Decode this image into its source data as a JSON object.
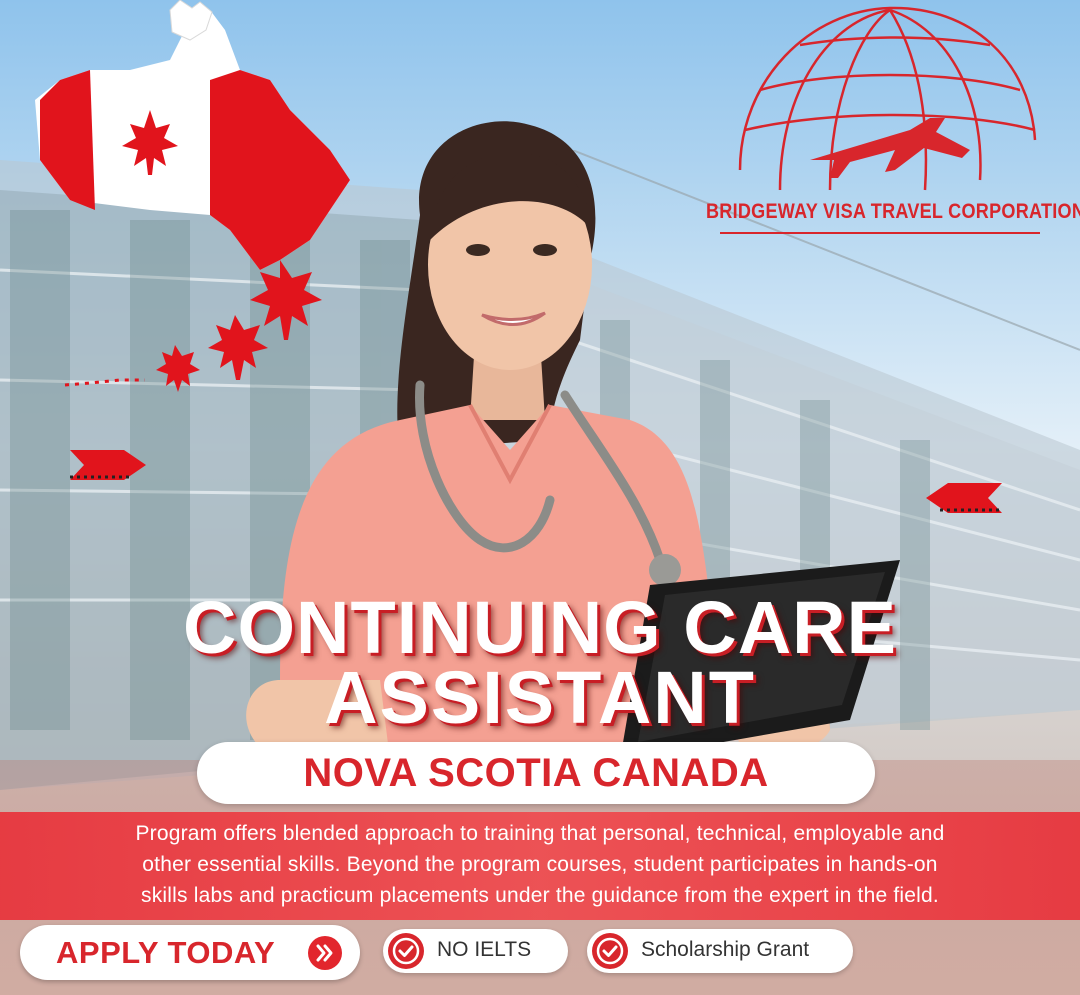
{
  "brand": {
    "name": "BRIDGEWAY VISA TRAVEL CORPORATION",
    "red": "#d8262c"
  },
  "headline": {
    "line1": "CONTINUING CARE",
    "line2": "ASSISTANT"
  },
  "location": "NOVA SCOTIA CANADA",
  "description": {
    "line1": "Program offers blended approach to training that personal, technical, employable and",
    "line2": "other essential skills. Beyond the program courses, student participates in hands-on",
    "line3": "skills labs and practicum placements under the guidance from the expert in the field."
  },
  "cta": {
    "apply_label": "APPLY TODAY",
    "apply_icon": "double-chevron-right-icon"
  },
  "features": [
    {
      "label": "NO IELTS",
      "icon": "check-circle-icon"
    },
    {
      "label": "Scholarship Grant",
      "icon": "check-circle-icon"
    }
  ],
  "graphics": {
    "map": "canada-flag-map",
    "logo": "globe-with-airplane",
    "photo": "nurse-in-pink-scrubs-with-stethoscope-and-tablet"
  }
}
